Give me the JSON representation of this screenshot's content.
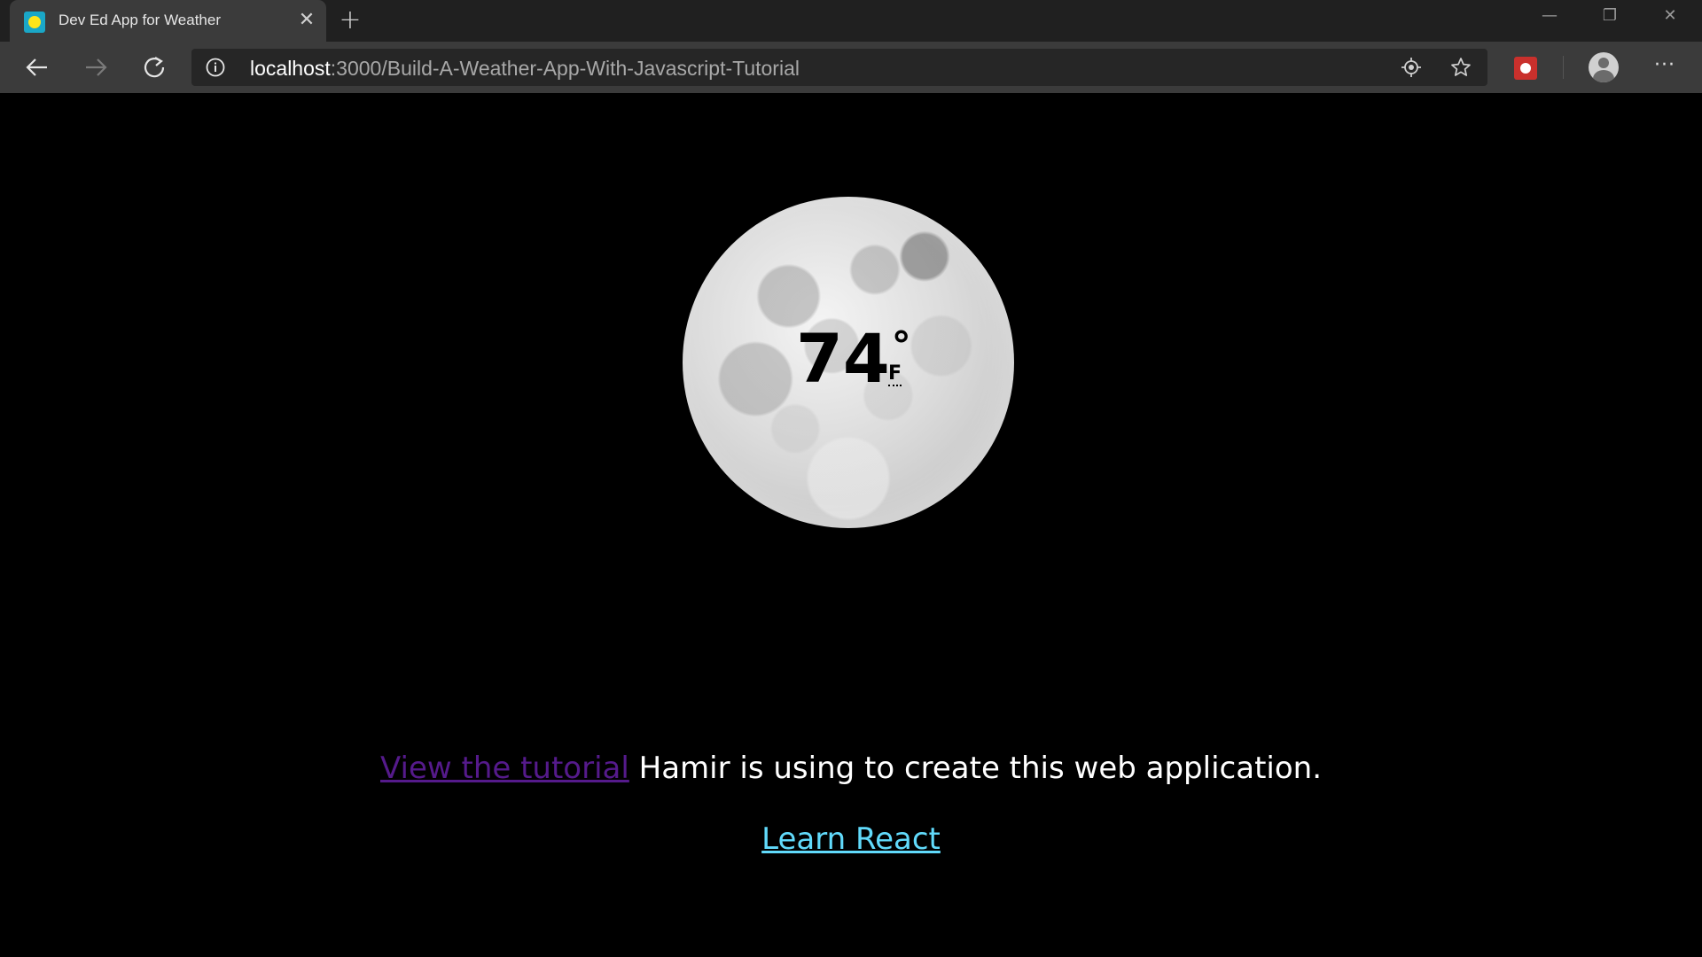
{
  "browser": {
    "tab": {
      "title": "Dev Ed App for Weather",
      "close_glyph": "✕",
      "favicon": "weather-sun-icon"
    },
    "new_tab_glyph": "+",
    "window_controls": {
      "minimize": "—",
      "maximize": "❐",
      "close": "✕"
    },
    "toolbar": {
      "url_host": "localhost",
      "url_rest": ":3000/Build-A-Weather-App-With-Javascript-Tutorial",
      "more_glyph": "···"
    }
  },
  "weather": {
    "temperature": "74",
    "degree_symbol": "°",
    "unit": "F",
    "icon": "full-moon-icon"
  },
  "content": {
    "tutorial_link_text": "View the tutorial",
    "tutorial_suffix": " Hamir is using to create this web application.",
    "learn_react_text": "Learn React"
  },
  "colors": {
    "visited_link": "#551a8b",
    "react_link": "#61dafb",
    "page_background": "#000000",
    "toolbar_background": "#3b3b3b"
  }
}
